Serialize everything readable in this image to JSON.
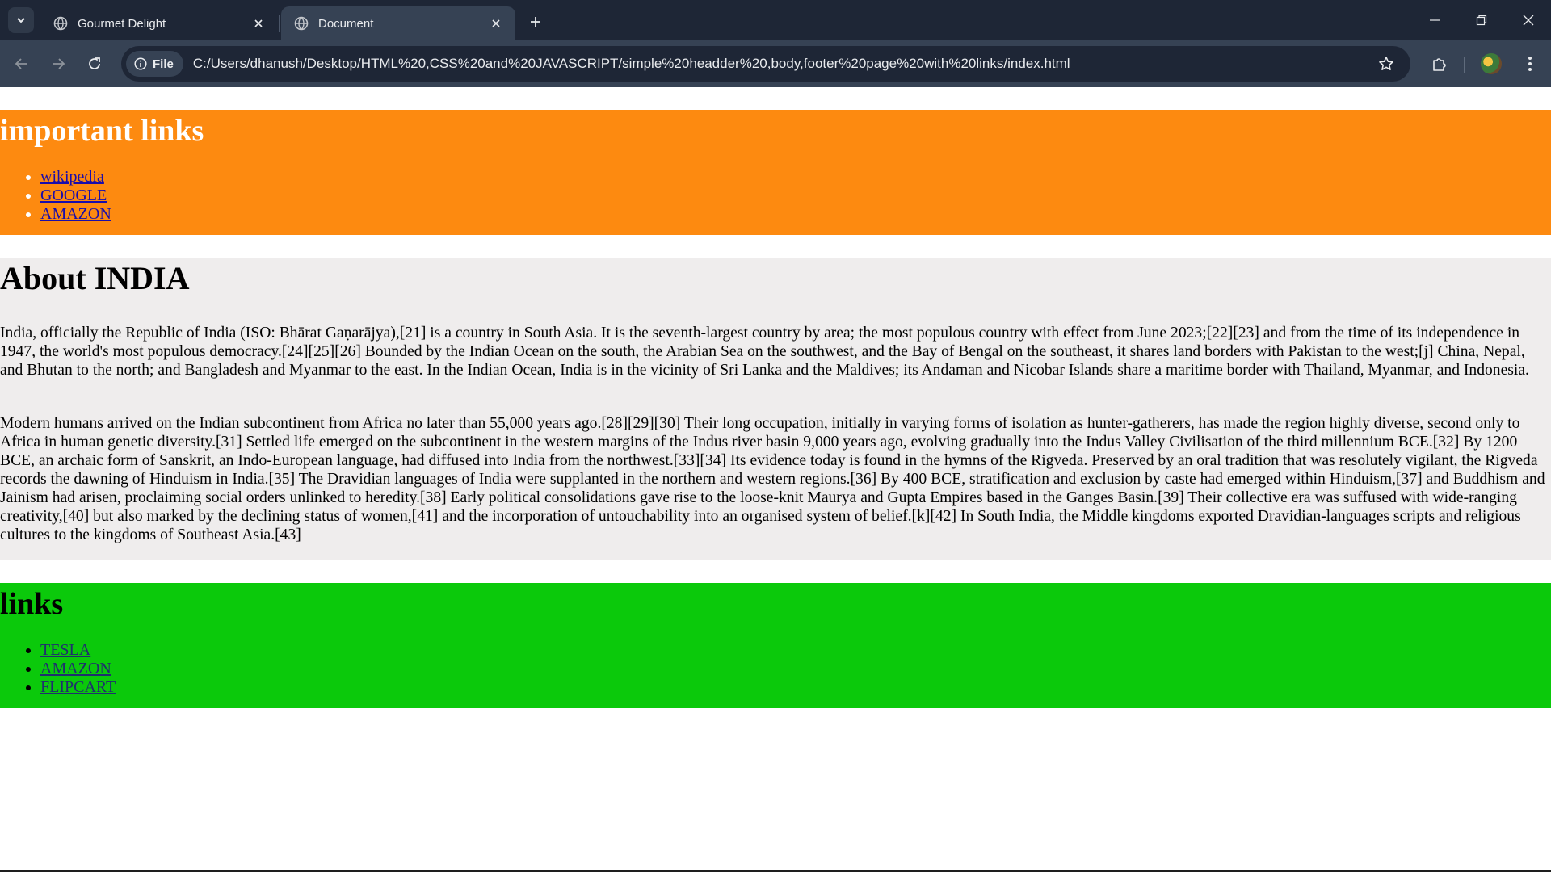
{
  "browser": {
    "tabs": [
      {
        "title": "Gourmet Delight",
        "icon": "globe-icon",
        "active": false
      },
      {
        "title": "Document",
        "icon": "globe-icon",
        "active": true
      }
    ],
    "address_bar": {
      "chip_label": "File",
      "url": "C:/Users/dhanush/Desktop/HTML%20,CSS%20and%20JAVASCRIPT/simple%20headder%20,body,footer%20page%20with%20links/index.html"
    },
    "icons": {
      "tab_search": "chevron-down-icon",
      "new_tab": "plus-icon",
      "back": "arrow-left-icon",
      "forward": "arrow-right-icon",
      "reload": "reload-icon",
      "info": "info-icon",
      "bookmark": "star-icon",
      "extensions": "puzzle-icon",
      "profile": "avatar",
      "menu": "kebab-menu-icon",
      "minimize": "minimize-icon",
      "maximize": "restore-icon",
      "close": "close-icon"
    }
  },
  "page": {
    "header": {
      "title": "important links",
      "bg_color": "#fd8a10",
      "links": [
        {
          "label": "wikipedia"
        },
        {
          "label": "GOOGLE"
        },
        {
          "label": "AMAZON"
        }
      ]
    },
    "about": {
      "title": "About INDIA",
      "bg_color": "#efeded",
      "paragraphs": [
        "India, officially the Republic of India (ISO: Bhārat Gaṇarājya),[21] is a country in South Asia. It is the seventh-largest country by area; the most populous country with effect from June 2023;[22][23] and from the time of its independence in 1947, the world's most populous democracy.[24][25][26] Bounded by the Indian Ocean on the south, the Arabian Sea on the southwest, and the Bay of Bengal on the southeast, it shares land borders with Pakistan to the west;[j] China, Nepal, and Bhutan to the north; and Bangladesh and Myanmar to the east. In the Indian Ocean, India is in the vicinity of Sri Lanka and the Maldives; its Andaman and Nicobar Islands share a maritime border with Thailand, Myanmar, and Indonesia.",
        "Modern humans arrived on the Indian subcontinent from Africa no later than 55,000 years ago.[28][29][30] Their long occupation, initially in varying forms of isolation as hunter-gatherers, has made the region highly diverse, second only to Africa in human genetic diversity.[31] Settled life emerged on the subcontinent in the western margins of the Indus river basin 9,000 years ago, evolving gradually into the Indus Valley Civilisation of the third millennium BCE.[32] By 1200 BCE, an archaic form of Sanskrit, an Indo-European language, had diffused into India from the northwest.[33][34] Its evidence today is found in the hymns of the Rigveda. Preserved by an oral tradition that was resolutely vigilant, the Rigveda records the dawning of Hinduism in India.[35] The Dravidian languages of India were supplanted in the northern and western regions.[36] By 400 BCE, stratification and exclusion by caste had emerged within Hinduism,[37] and Buddhism and Jainism had arisen, proclaiming social orders unlinked to heredity.[38] Early political consolidations gave rise to the loose-knit Maurya and Gupta Empires based in the Ganges Basin.[39] Their collective era was suffused with wide-ranging creativity,[40] but also marked by the declining status of women,[41] and the incorporation of untouchability into an organised system of belief.[k][42] In South India, the Middle kingdoms exported Dravidian-languages scripts and religious cultures to the kingdoms of Southeast Asia.[43]"
      ]
    },
    "footer": {
      "title": "links",
      "bg_color": "#0bc90b",
      "links": [
        {
          "label": "TESLA"
        },
        {
          "label": "AMAZON"
        },
        {
          "label": "FLIPCART"
        }
      ]
    }
  }
}
